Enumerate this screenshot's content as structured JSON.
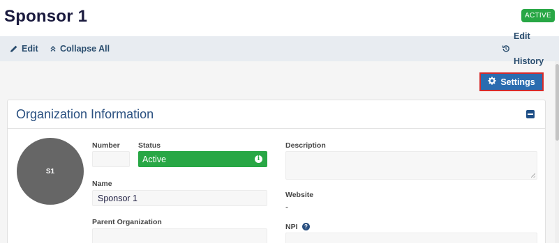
{
  "header": {
    "title": "Sponsor 1",
    "status_badge": "ACTIVE"
  },
  "toolbar": {
    "edit_label": "Edit",
    "collapse_label": "Collapse All",
    "history_label": "Edit History"
  },
  "actions": {
    "settings_label": "Settings"
  },
  "card": {
    "title": "Organization Information",
    "avatar_initials": "S1",
    "fields": {
      "number_label": "Number",
      "number_value": "",
      "status_label": "Status",
      "status_value": "Active",
      "name_label": "Name",
      "name_value": "Sponsor 1",
      "parent_label": "Parent Organization",
      "parent_value": "",
      "description_label": "Description",
      "description_value": "",
      "website_label": "Website",
      "website_value": "-",
      "npi_label": "NPI",
      "npi_value": ""
    }
  },
  "icons": {
    "edit": "pencil-icon",
    "collapse": "double-chevron-up-icon",
    "history": "history-icon",
    "settings": "gear-icon",
    "collapse_card": "minus-square-icon",
    "status_info": "info-circle-icon",
    "npi_help": "question-circle-icon"
  },
  "colors": {
    "active_green": "#28a745",
    "primary_blue": "#2a6cb0",
    "title_navy": "#1a1a3e",
    "link_blue": "#2a4d6e",
    "highlight_red": "#d62a2a",
    "avatar_gray": "#666666"
  }
}
